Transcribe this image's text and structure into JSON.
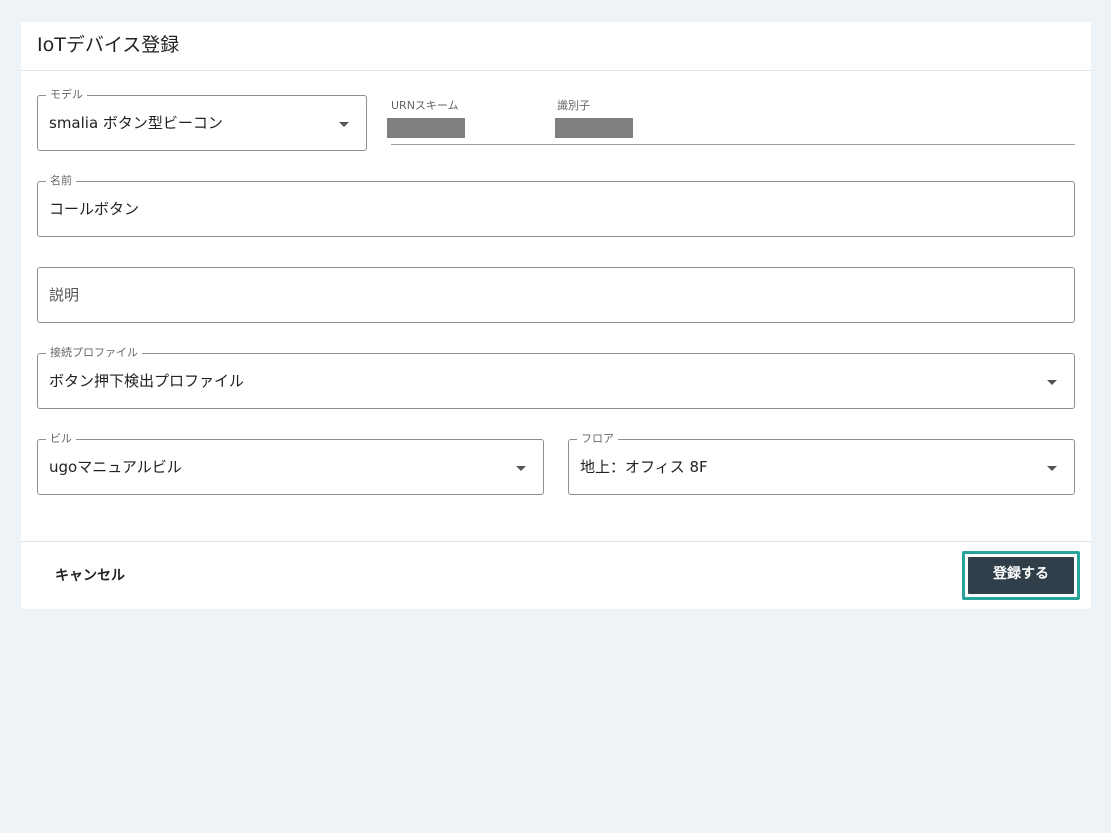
{
  "dialog": {
    "title": "IoTデバイス登録"
  },
  "form": {
    "model": {
      "label": "モデル",
      "value": "smalia ボタン型ビーコン"
    },
    "urn_scheme": {
      "label": "URNスキーム"
    },
    "identifier": {
      "label": "識別子"
    },
    "name": {
      "label": "名前",
      "value": "コールボタン"
    },
    "description": {
      "placeholder": "説明"
    },
    "connection_profile": {
      "label": "接続プロファイル",
      "value": "ボタン押下検出プロファイル"
    },
    "building": {
      "label": "ビル",
      "value": "ugoマニュアルビル"
    },
    "floor": {
      "label": "フロア",
      "value": "地上：オフィス 8F"
    }
  },
  "actions": {
    "cancel_label": "キャンセル",
    "submit_label": "登録する"
  },
  "colors": {
    "page_background": "#edf3f6",
    "submit_background": "#2f3e48",
    "focus_ring": "#27a39a",
    "redaction": "#808080"
  },
  "icons": {
    "select_caret": "caret-down-icon"
  }
}
